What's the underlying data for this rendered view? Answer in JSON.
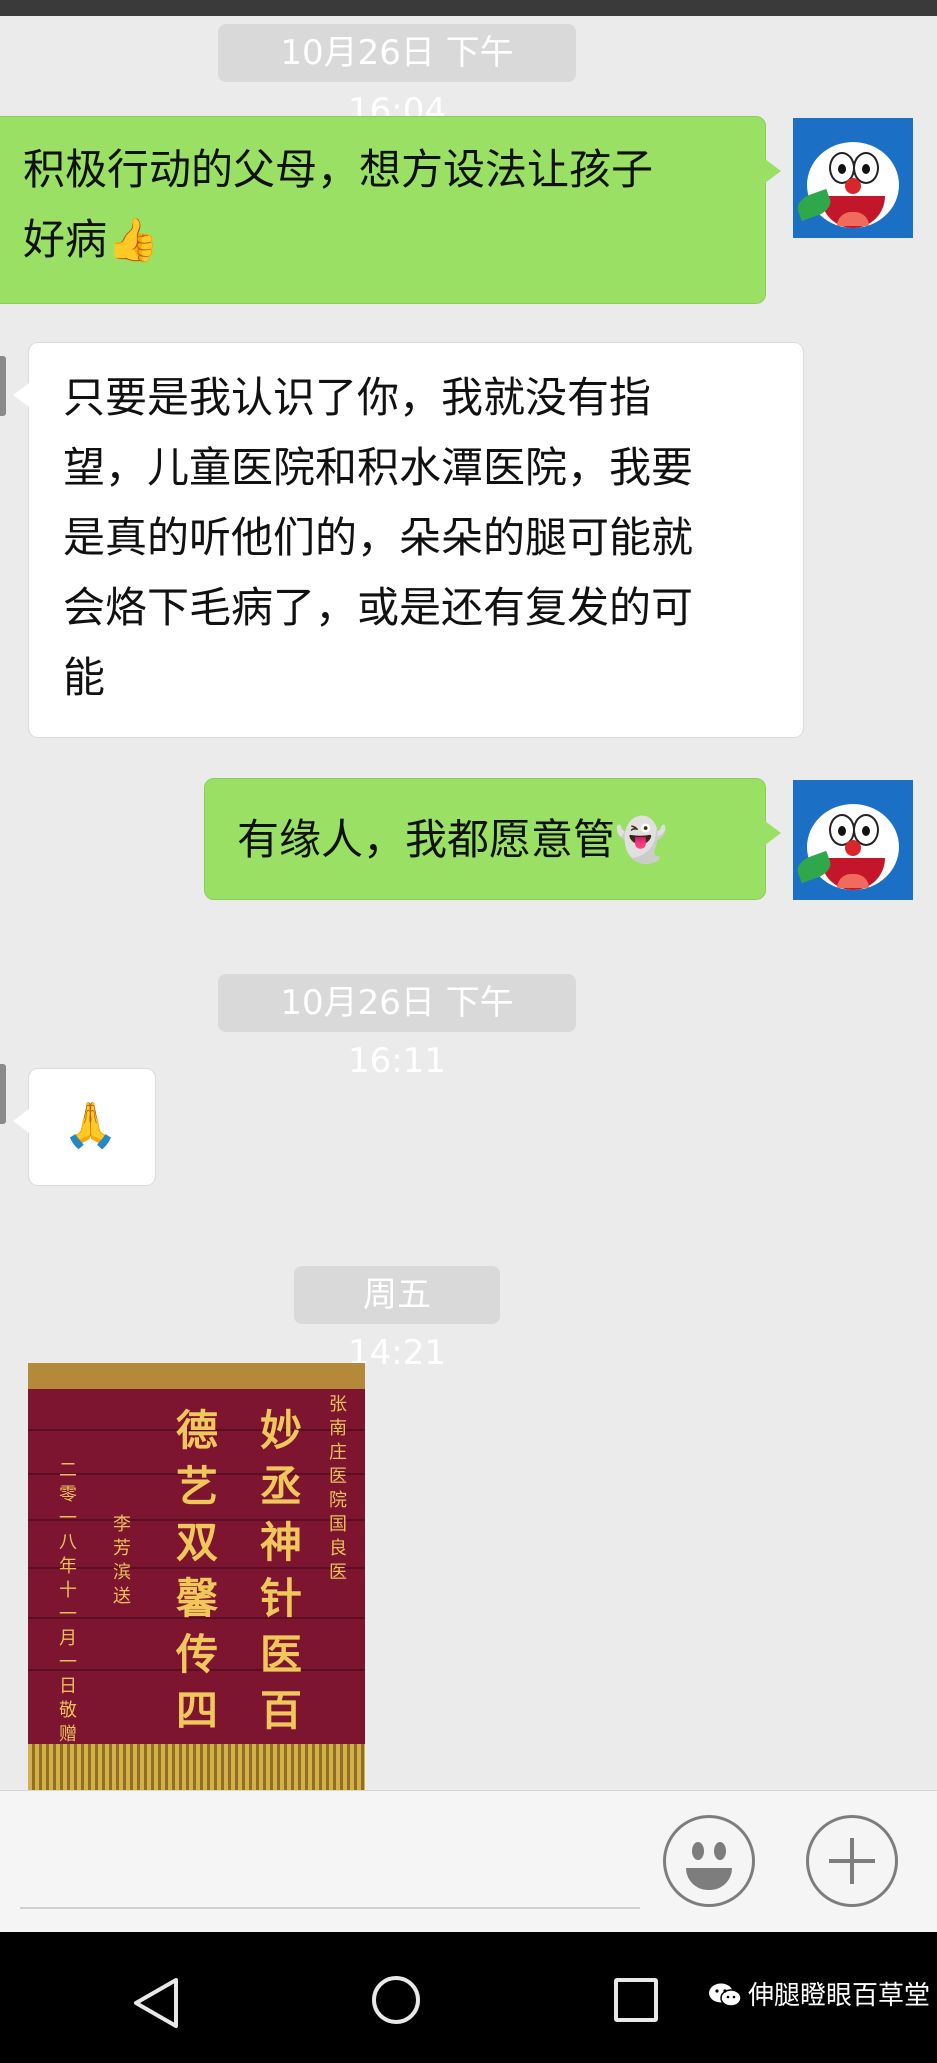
{
  "timestamps": [
    "10月26日 下午16:04",
    "10月26日 下午16:11",
    "周五 14:21"
  ],
  "messages": [
    {
      "side": "right",
      "text": "积极行动的父母，想方设法让孩子\n好病👍"
    },
    {
      "side": "left",
      "text": "只要是我认识了你，我就没有指\n望，儿童医院和积水潭医院，我要\n是真的听他们的，朵朵的腿可能就\n会烙下毛病了，或是还有复发的可\n能"
    },
    {
      "side": "right",
      "text": "有缘人，我都愿意管👻"
    },
    {
      "side": "left",
      "text": "🙏"
    }
  ],
  "banner": {
    "columns": [
      "妙丞神针医百病",
      "德艺双馨传四方"
    ],
    "dedication": "张南庄医院国良医",
    "sender": "李芳滨送",
    "date": "二零一八年十一月一日敬赠"
  },
  "input_bar": {
    "emoji_button": "emoji",
    "plus_button": "more"
  },
  "watermark": "伸腿瞪眼百草堂"
}
